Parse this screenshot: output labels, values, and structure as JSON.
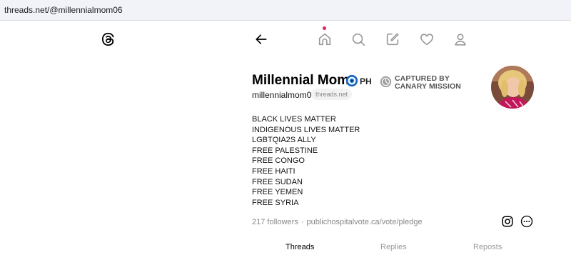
{
  "browser": {
    "url": "threads.net/@millennialmom06"
  },
  "nav": {
    "icons": [
      "threads-logo-icon",
      "back-arrow-icon",
      "home-icon",
      "search-icon",
      "compose-icon",
      "heart-icon",
      "profile-icon"
    ],
    "notification_color": "#e0245e"
  },
  "profile": {
    "name": "Millennial Mom",
    "flag_code": "PH",
    "captured_line1": "CAPTURED BY",
    "captured_line2": "CANARY MISSION",
    "username": "millennialmom06",
    "domain_badge": "threads.net",
    "bio": [
      "BLACK LIVES MATTER",
      "INDIGENOUS LIVES MATTER",
      "LGBTQIA2S ALLY",
      "FREE PALESTINE",
      "FREE CONGO",
      "FREE HAITI",
      "FREE SUDAN",
      "FREE YEMEN",
      "FREE SYRIA"
    ],
    "followers": "217 followers",
    "separator": "·",
    "link": "publichospitalvote.ca/vote/pledge"
  },
  "tabs": {
    "threads": "Threads",
    "replies": "Replies",
    "reposts": "Reposts"
  }
}
